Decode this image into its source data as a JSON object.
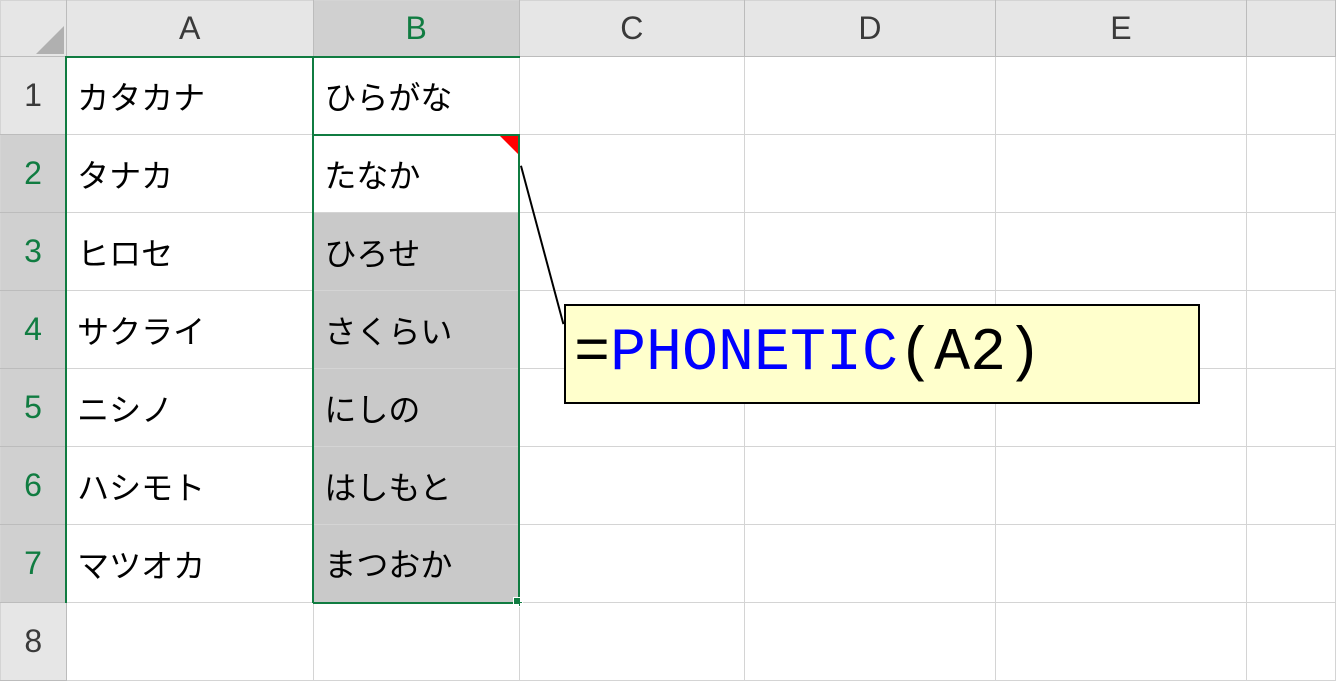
{
  "columns": {
    "A": "A",
    "B": "B",
    "C": "C",
    "D": "D",
    "E": "E"
  },
  "rows": {
    "r1": "1",
    "r2": "2",
    "r3": "3",
    "r4": "4",
    "r5": "5",
    "r6": "6",
    "r7": "7",
    "r8": "8"
  },
  "headers": {
    "A": "カタカナ",
    "B": "ひらがな"
  },
  "data": {
    "A": [
      "タナカ",
      "ヒロセ",
      "サクライ",
      "ニシノ",
      "ハシモト",
      "マツオカ"
    ],
    "B": [
      "たなか",
      "ひろせ",
      "さくらい",
      "にしの",
      "はしもと",
      "まつおか"
    ]
  },
  "selection": {
    "range": "B2:B7",
    "active": "B2"
  },
  "formula": {
    "eq": "=",
    "fn": "PHONETIC",
    "open": "(",
    "ref": "A2",
    "close": ")"
  }
}
